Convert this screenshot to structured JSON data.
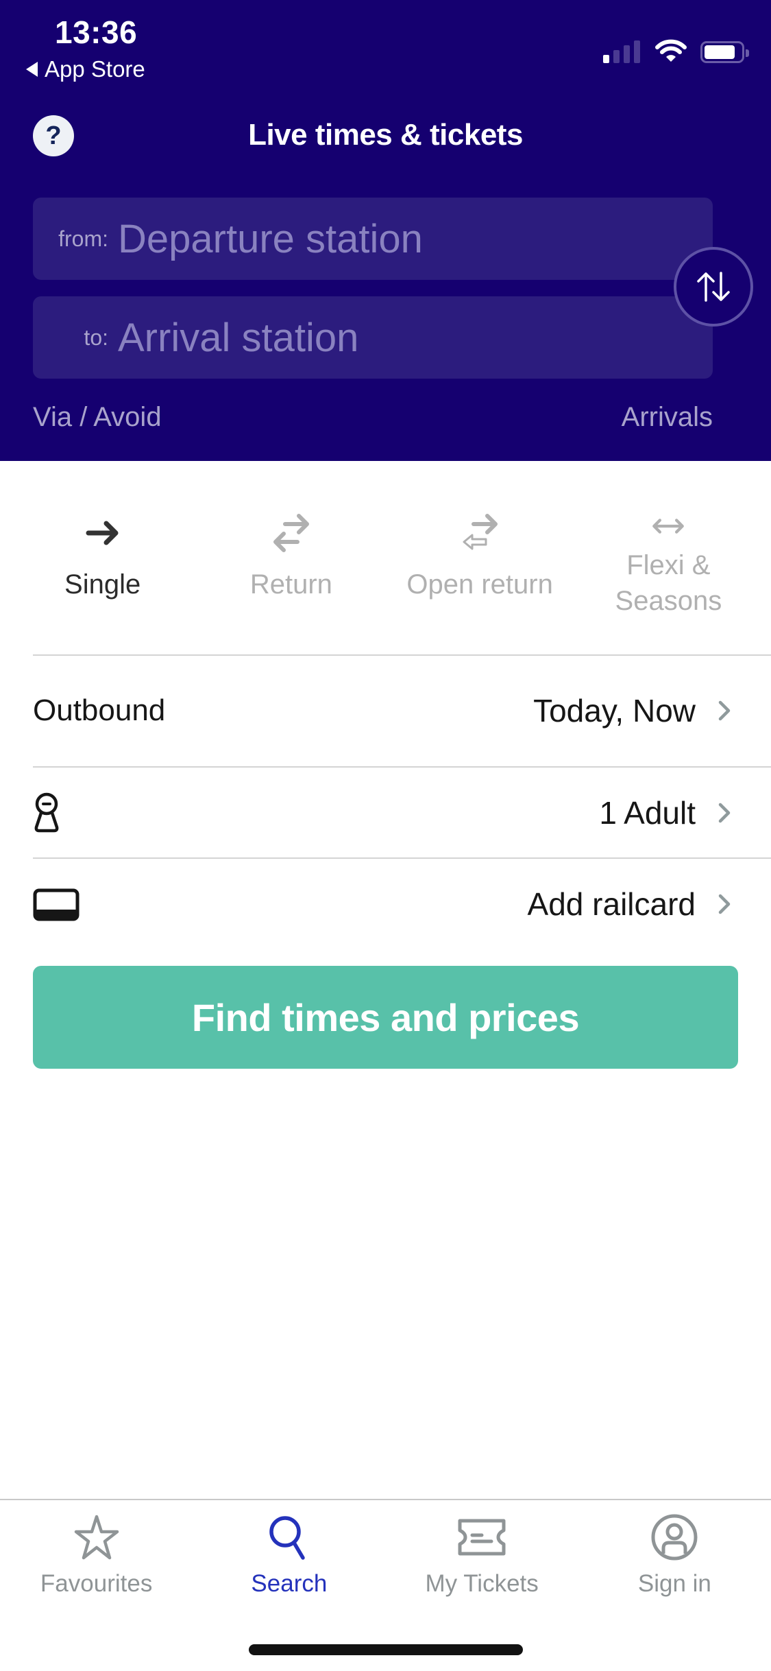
{
  "status_bar": {
    "time": "13:36",
    "back_app": "App Store",
    "signal_bars_filled": 1,
    "signal_bars_total": 4,
    "battery_level": 0.85
  },
  "header": {
    "title": "Live times & tickets",
    "help_icon": "question-mark-icon",
    "from_label": "from:",
    "from_placeholder": "Departure station",
    "to_label": "to:",
    "to_placeholder": "Arrival station",
    "swap_icon": "swap-up-down-icon",
    "via_avoid": "Via / Avoid",
    "arrivals": "Arrivals"
  },
  "ticket_types": [
    {
      "label": "Single",
      "icon": "arrow-right-icon",
      "active": true
    },
    {
      "label": "Return",
      "icon": "return-arrows-icon",
      "active": false
    },
    {
      "label": "Open return",
      "icon": "open-return-arrows-icon",
      "active": false
    },
    {
      "label": "Flexi & Seasons",
      "label_line1": "Flexi &",
      "label_line2": "Seasons",
      "icon": "double-arrow-icon",
      "active": false
    }
  ],
  "options": {
    "outbound_label": "Outbound",
    "outbound_value": "Today, Now",
    "passengers_value": "1 Adult",
    "railcard_value": "Add railcard"
  },
  "find_button": "Find times and prices",
  "tab_bar": [
    {
      "label": "Favourites",
      "icon": "star-icon",
      "active": false
    },
    {
      "label": "Search",
      "icon": "search-icon",
      "active": true
    },
    {
      "label": "My Tickets",
      "icon": "ticket-icon",
      "active": false
    },
    {
      "label": "Sign in",
      "icon": "user-circle-icon",
      "active": false
    }
  ],
  "colors": {
    "header_bg": "#150070",
    "field_bg": "#2c1c7e",
    "muted_header_text": "#a9a3cc",
    "primary_button": "#58c1a9",
    "tab_active": "#2432bb",
    "tab_inactive": "#8f9496"
  }
}
